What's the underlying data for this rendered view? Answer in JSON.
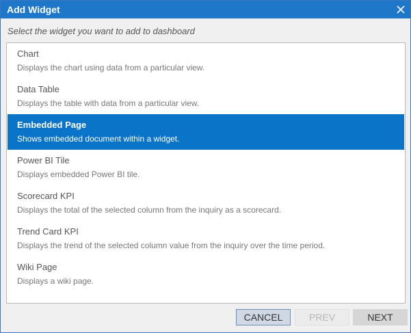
{
  "dialog": {
    "title": "Add Widget",
    "instruction": "Select the widget you want to add to dashboard",
    "close_icon": "close-icon"
  },
  "widgets": [
    {
      "name": "Chart",
      "description": "Displays the chart using data from a particular view.",
      "selected": false
    },
    {
      "name": "Data Table",
      "description": "Displays the table with data from a particular view.",
      "selected": false
    },
    {
      "name": "Embedded Page",
      "description": "Shows embedded document within a widget.",
      "selected": true
    },
    {
      "name": "Power BI Tile",
      "description": "Displays embedded Power BI tile.",
      "selected": false
    },
    {
      "name": "Scorecard KPI",
      "description": "Displays the total of the selected column from the inquiry as a scorecard.",
      "selected": false
    },
    {
      "name": "Trend Card KPI",
      "description": "Displays the trend of the selected column value from the inquiry over the time period.",
      "selected": false
    },
    {
      "name": "Wiki Page",
      "description": "Displays a wiki page.",
      "selected": false
    }
  ],
  "buttons": {
    "cancel": "CANCEL",
    "prev": "PREV",
    "next": "NEXT"
  },
  "colors": {
    "titlebar": "#1e77c8",
    "selected": "#0a74c9"
  }
}
